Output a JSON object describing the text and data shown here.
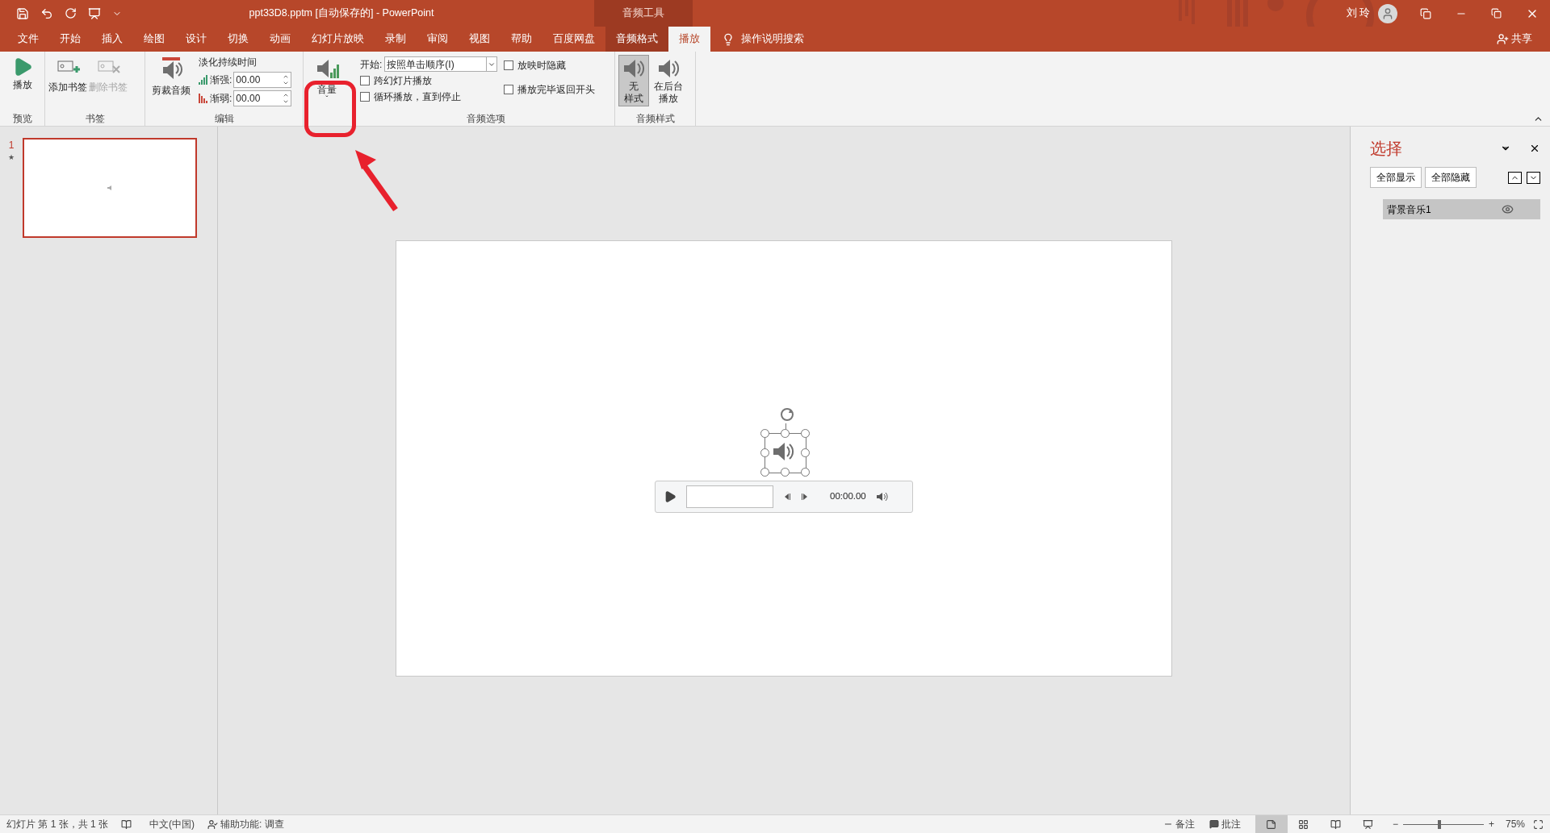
{
  "title_bar": {
    "title": "ppt33D8.pptm [自动保存的]  -  PowerPoint",
    "context_label": "音频工具",
    "user": "刘 玲"
  },
  "tabs": [
    {
      "label": "文件",
      "kind": "normal",
      "selected": false
    },
    {
      "label": "开始",
      "kind": "normal",
      "selected": false
    },
    {
      "label": "插入",
      "kind": "normal",
      "selected": false
    },
    {
      "label": "绘图",
      "kind": "normal",
      "selected": false
    },
    {
      "label": "设计",
      "kind": "normal",
      "selected": false
    },
    {
      "label": "切换",
      "kind": "normal",
      "selected": false
    },
    {
      "label": "动画",
      "kind": "normal",
      "selected": false
    },
    {
      "label": "幻灯片放映",
      "kind": "normal",
      "selected": false
    },
    {
      "label": "录制",
      "kind": "normal",
      "selected": false
    },
    {
      "label": "审阅",
      "kind": "normal",
      "selected": false
    },
    {
      "label": "视图",
      "kind": "normal",
      "selected": false
    },
    {
      "label": "帮助",
      "kind": "normal",
      "selected": false
    },
    {
      "label": "百度网盘",
      "kind": "normal",
      "selected": false
    },
    {
      "label": "音频格式",
      "kind": "contextual",
      "selected": false
    },
    {
      "label": "播放",
      "kind": "contextual",
      "selected": true
    }
  ],
  "tell_me": "操作说明搜索",
  "share": "共享",
  "ribbon": {
    "preview": {
      "play": "播放",
      "label": "预览"
    },
    "bookmarks": {
      "add": {
        "label": "添加书签",
        "disabled": false
      },
      "remove": {
        "label": "删除书签",
        "disabled": true
      },
      "label": "书签"
    },
    "editing": {
      "trim": "剪裁音频",
      "fade_title": "淡化持续时间",
      "fade_in": {
        "label": "渐强:",
        "value": "00.00"
      },
      "fade_out": {
        "label": "渐弱:",
        "value": "00.00"
      },
      "label": "编辑"
    },
    "volume": {
      "label": "音量",
      "caret": "ˇ"
    },
    "audio_options": {
      "start_label": "开始:",
      "start_value": "按照单击顺序(I)",
      "checkboxes": [
        {
          "label": "跨幻灯片播放",
          "checked": false
        },
        {
          "label": "循环播放，直到停止",
          "checked": false
        },
        {
          "label": "放映时隐藏",
          "checked": false
        },
        {
          "label": "播放完毕返回开头",
          "checked": false
        }
      ],
      "label": "音频选项"
    },
    "styles": {
      "items": [
        {
          "lines": [
            "无",
            "样式"
          ],
          "selected": true
        },
        {
          "lines": [
            "在后台",
            "播放"
          ],
          "selected": false
        }
      ],
      "label": "音频样式"
    }
  },
  "thumbnails": [
    {
      "number": "1",
      "mark": "★",
      "selected": true
    }
  ],
  "player": {
    "time": "00:00.00"
  },
  "selection_pane": {
    "title": "选择",
    "buttons": [
      "全部显示",
      "全部隐藏"
    ],
    "items": [
      {
        "name": "背景音乐1",
        "selected": true,
        "visible": true
      }
    ]
  },
  "status_bar": {
    "slide_info": "幻灯片 第 1 张，共 1 张",
    "language": "中文(中国)",
    "accessibility": "辅助功能: 调查",
    "notes": "备注",
    "comments": "批注",
    "views": [
      {
        "kind": "normal",
        "selected": true
      },
      {
        "kind": "sorter",
        "selected": false
      },
      {
        "kind": "reading",
        "selected": false
      },
      {
        "kind": "show",
        "selected": false
      }
    ],
    "zoom": {
      "minus": "−",
      "plus": "+",
      "level": 0.45,
      "text": "75%"
    }
  }
}
